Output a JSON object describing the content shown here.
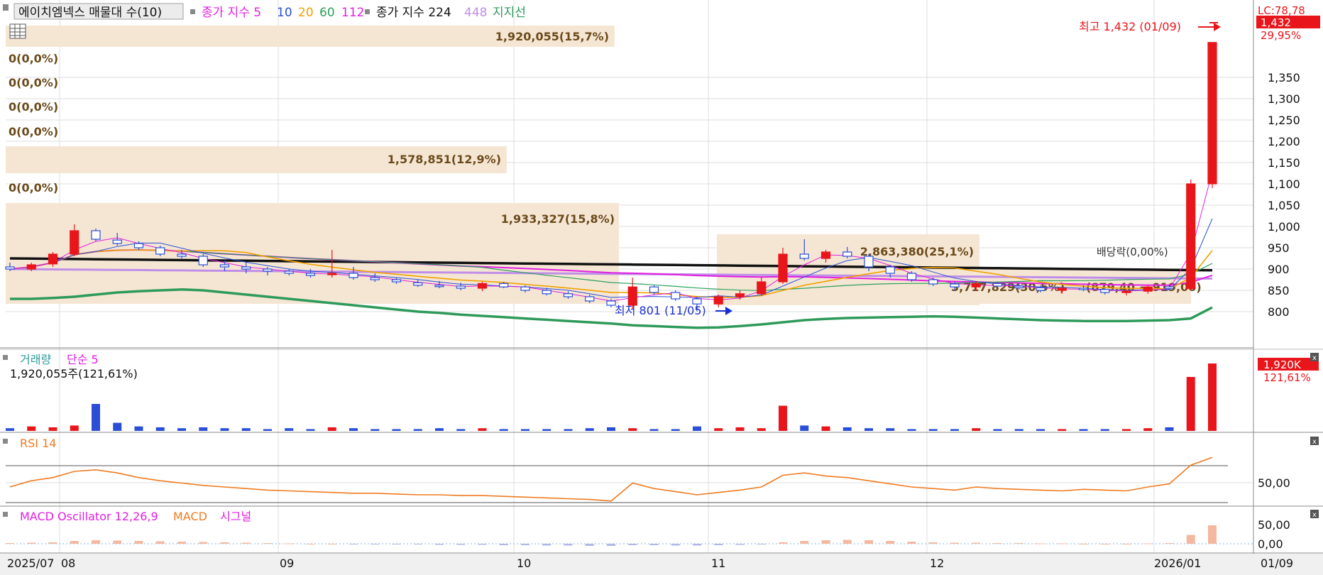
{
  "colors": {
    "up": "#e8161b",
    "down": "#2a4fd6",
    "ma5": "#e020e0",
    "ma10": "#2a4fd6",
    "ma20": "#f0a000",
    "ma60": "#2aa05a",
    "ma112": "#e020e0",
    "ma224": "#111111",
    "ma448": "#c08ee8",
    "support": "#2e9a5a",
    "volume": "#e8161b",
    "rsi": "#f07a20",
    "macd": "#f07a20",
    "band": "#f5e6d4",
    "grid": "#dcdcdc"
  },
  "legend": {
    "title": "에이치엠넥스 매물대 수(10)",
    "ma_label": "종가 지수 5",
    "ma10": "10",
    "ma20": "20",
    "ma60": "60",
    "ma112": "112",
    "ma224_label": "종가 지수 224",
    "ma448": "448",
    "support": "지지선"
  },
  "price_axis": {
    "ticks": [
      "1,350",
      "1,300",
      "1,250",
      "1,200",
      "1,150",
      "1,100",
      "1,050",
      "1,000",
      "950",
      "900",
      "850",
      "800"
    ],
    "lc_label": "LC:78,78",
    "current_badge": "1,432",
    "current_pct": "29,95%"
  },
  "profile_labels": {
    "band1": "1,920,055(15,7%)",
    "band2": "1,578,851(12,9%)",
    "band3": "1,933,327(15,8%)",
    "band4": "2,863,380(25,1%)",
    "band5": "3,717,829(30,5%)",
    "zero1": "0(0,0%)",
    "zero2": "0(0,0%)",
    "zero3": "0(0,0%)",
    "zero4": "0(0,0%)",
    "zero5": "0(0,0%)",
    "mid_price": "(879,40 ~ 919,00)",
    "mid_label": "배당락(0,00%)"
  },
  "annotations": {
    "high": "최고 1,432 (01/09)",
    "low": "최저 801 (11/05)"
  },
  "volume_panel": {
    "title": "거래량",
    "ma_label": "단순 5",
    "readout": "1,920,055주(121,61%)",
    "badge": "1,920K",
    "badge_pct": "121,61%"
  },
  "rsi_panel": {
    "title": "RSI 14",
    "tick": "50,00"
  },
  "macd_panel": {
    "title": "MACD Oscillator 12,26,9",
    "macd_label": "MACD",
    "signal_label": "시그널",
    "ticks": [
      "50,00",
      "0,00"
    ]
  },
  "date_axis": {
    "labels": [
      "2025/07",
      "08",
      "09",
      "10",
      "11",
      "12",
      "2026/01"
    ],
    "last_date": "01/09"
  },
  "chart_data": {
    "type": "candlestick",
    "x": [
      "07/29",
      "07/31",
      "08/04",
      "08/06",
      "08/08",
      "08/12",
      "08/14",
      "08/19",
      "08/21",
      "08/25",
      "08/27",
      "08/29",
      "09/02",
      "09/04",
      "09/08",
      "09/10",
      "09/12",
      "09/16",
      "09/18",
      "09/22",
      "09/24",
      "09/26",
      "09/30",
      "10/02",
      "10/10",
      "10/14",
      "10/16",
      "10/20",
      "10/22",
      "10/24",
      "10/28",
      "10/30",
      "11/03",
      "11/05",
      "11/07",
      "11/11",
      "11/13",
      "11/17",
      "11/19",
      "11/21",
      "11/25",
      "11/27",
      "12/01",
      "12/03",
      "12/05",
      "12/09",
      "12/11",
      "12/15",
      "12/17",
      "12/19",
      "12/23",
      "12/26",
      "12/30",
      "01/02",
      "01/06",
      "01/08",
      "01/09"
    ],
    "ohlc": [
      [
        905,
        915,
        895,
        900
      ],
      [
        900,
        915,
        895,
        910
      ],
      [
        912,
        940,
        905,
        935
      ],
      [
        935,
        1005,
        930,
        990
      ],
      [
        990,
        995,
        965,
        970
      ],
      [
        968,
        985,
        955,
        960
      ],
      [
        960,
        965,
        945,
        950
      ],
      [
        950,
        955,
        930,
        935
      ],
      [
        935,
        945,
        925,
        930
      ],
      [
        930,
        935,
        905,
        910
      ],
      [
        910,
        920,
        895,
        905
      ],
      [
        905,
        915,
        890,
        900
      ],
      [
        900,
        905,
        885,
        895
      ],
      [
        895,
        900,
        885,
        890
      ],
      [
        890,
        900,
        880,
        885
      ],
      [
        888,
        945,
        880,
        890
      ],
      [
        890,
        905,
        875,
        880
      ],
      [
        880,
        890,
        870,
        875
      ],
      [
        875,
        880,
        865,
        870
      ],
      [
        868,
        875,
        858,
        862
      ],
      [
        862,
        872,
        855,
        860
      ],
      [
        860,
        868,
        850,
        855
      ],
      [
        855,
        870,
        848,
        866
      ],
      [
        866,
        870,
        855,
        858
      ],
      [
        858,
        862,
        845,
        850
      ],
      [
        850,
        856,
        838,
        842
      ],
      [
        842,
        848,
        830,
        835
      ],
      [
        835,
        840,
        820,
        825
      ],
      [
        825,
        830,
        810,
        815
      ],
      [
        815,
        880,
        805,
        858
      ],
      [
        858,
        862,
        840,
        845
      ],
      [
        845,
        850,
        825,
        830
      ],
      [
        830,
        835,
        801,
        818
      ],
      [
        818,
        840,
        810,
        835
      ],
      [
        835,
        850,
        828,
        842
      ],
      [
        842,
        880,
        838,
        870
      ],
      [
        870,
        950,
        865,
        935
      ],
      [
        935,
        970,
        920,
        925
      ],
      [
        925,
        945,
        915,
        940
      ],
      [
        940,
        952,
        925,
        930
      ],
      [
        930,
        935,
        895,
        905
      ],
      [
        905,
        910,
        880,
        890
      ],
      [
        890,
        895,
        870,
        875
      ],
      [
        875,
        880,
        860,
        865
      ],
      [
        865,
        870,
        850,
        858
      ],
      [
        858,
        872,
        850,
        866
      ],
      [
        866,
        870,
        855,
        860
      ],
      [
        860,
        866,
        852,
        856
      ],
      [
        856,
        862,
        845,
        850
      ],
      [
        850,
        858,
        842,
        855
      ],
      [
        855,
        862,
        848,
        852
      ],
      [
        852,
        856,
        840,
        845
      ],
      [
        845,
        852,
        838,
        848
      ],
      [
        848,
        862,
        842,
        858
      ],
      [
        858,
        864,
        850,
        854
      ],
      [
        854,
        1110,
        850,
        1100
      ],
      [
        1100,
        1432,
        1090,
        1432
      ]
    ],
    "volume": [
      3,
      5,
      4,
      6,
      30,
      9,
      5,
      4,
      3,
      4,
      3,
      3,
      2,
      3,
      2,
      4,
      3,
      2,
      2,
      2,
      3,
      2,
      3,
      2,
      2,
      2,
      2,
      3,
      4,
      3,
      2,
      2,
      5,
      3,
      4,
      3,
      28,
      6,
      5,
      4,
      3,
      3,
      2,
      2,
      2,
      3,
      2,
      2,
      2,
      2,
      2,
      2,
      2,
      3,
      4,
      60,
      75
    ],
    "rsi": [
      40,
      48,
      52,
      60,
      62,
      58,
      52,
      48,
      45,
      42,
      40,
      38,
      36,
      35,
      34,
      33,
      32,
      32,
      31,
      30,
      30,
      29,
      29,
      28,
      27,
      26,
      25,
      24,
      22,
      45,
      38,
      34,
      30,
      33,
      36,
      40,
      55,
      58,
      54,
      52,
      48,
      44,
      40,
      38,
      36,
      40,
      38,
      37,
      36,
      35,
      37,
      36,
      35,
      40,
      44,
      68,
      78
    ],
    "macd": [
      2,
      3,
      4,
      8,
      10,
      9,
      8,
      7,
      6,
      5,
      4,
      3,
      2,
      1,
      0,
      0,
      -1,
      -1,
      -2,
      -2,
      -3,
      -3,
      -3,
      -4,
      -4,
      -5,
      -5,
      -6,
      -6,
      -4,
      -4,
      -5,
      -5,
      -4,
      -3,
      -2,
      4,
      8,
      10,
      11,
      10,
      8,
      6,
      4,
      3,
      3,
      2,
      2,
      1,
      1,
      0,
      0,
      0,
      1,
      2,
      25,
      52
    ],
    "price_range": [
      760,
      1440
    ],
    "annotations": {
      "high": 1432,
      "low": 801
    }
  }
}
